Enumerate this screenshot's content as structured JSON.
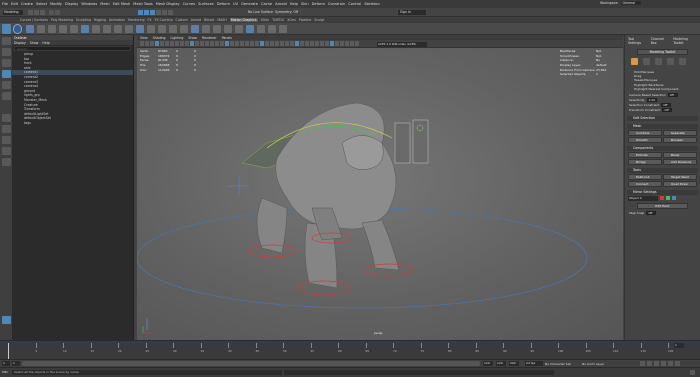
{
  "menubar": {
    "items": [
      "File",
      "Edit",
      "Create",
      "Select",
      "Modify",
      "Display",
      "Windows",
      "Mesh",
      "Edit Mesh",
      "Mesh Tools",
      "Mesh Display",
      "Curves",
      "Surfaces",
      "Deform",
      "UV",
      "Generate",
      "Cache",
      "Arnold",
      "Help",
      "Skin",
      "Deform",
      "Constrain",
      "Control",
      "Skeleton"
    ],
    "workspace_label": "Workspace:",
    "workspace_value": "General"
  },
  "statusline": {
    "mode": "Modeling",
    "symmetry": "Symmetry: Off",
    "live": "No Live Surface",
    "sign_in": "Sign In"
  },
  "shelf": {
    "tabs": [
      "Curves / Surfaces",
      "Poly Modeling",
      "Sculpting",
      "Rigging",
      "Animation",
      "Rendering",
      "FX",
      "FX Caching",
      "Custom",
      "Arnold",
      "Bifrost",
      "MASH",
      "Motion Graphics",
      "XGen",
      "TURTLE",
      "XGen",
      "Pipeline",
      "Sculpt"
    ],
    "active_index": 12
  },
  "outliner": {
    "menu": [
      "Display",
      "Show",
      "Help"
    ],
    "search_placeholder": "Search...",
    "items": [
      "persp",
      "top",
      "front",
      "side",
      "camera1",
      "camera2",
      "camera3",
      "camera4",
      "ground",
      "lights_grp",
      "Monster_Mesh",
      "Creature",
      "Transform",
      "defaultLightSet",
      "defaultObjectSet",
      "tags"
    ],
    "highlight_index": 4
  },
  "viewport": {
    "menu": [
      "View",
      "Shading",
      "Lighting",
      "Show",
      "Renderer",
      "Panels"
    ],
    "color_space": "ACES 1.0 SDR-video (ACES)",
    "camera_label": "persp",
    "hud_left": [
      [
        "Verts:",
        "87063",
        "0",
        "0"
      ],
      [
        "Edges:",
        "168374",
        "0",
        "0"
      ],
      [
        "Faces:",
        "81436",
        "0",
        "0"
      ],
      [
        "Tris:",
        "162848",
        "0",
        "0"
      ],
      [
        "UVs:",
        "110426",
        "0",
        "0"
      ]
    ],
    "hud_right": [
      [
        "Backfaces:",
        "N/A"
      ],
      [
        "Smoothness:",
        "N/A"
      ],
      [
        "Instance:",
        "No"
      ],
      [
        "Display Layer:",
        "default"
      ],
      [
        "Distance From Camera:",
        "23.891"
      ],
      [
        "Selected Objects:",
        "1"
      ]
    ]
  },
  "attribute_editor": {
    "tabs": [
      "Tool Settings",
      "Channel Box",
      "Modeling Toolkit"
    ],
    "title": "Modeling Toolkit",
    "subtabs": [
      "Object",
      "Vertex",
      "Edge",
      "Face",
      "UV"
    ],
    "pick_label": "Pick/Marquee",
    "options": [
      "Drag",
      "Tweak/Marquee",
      "Highlight Backfaces",
      "Highlight Nearest Component"
    ],
    "fields": [
      [
        "Camera Based Selection",
        "Off"
      ],
      [
        "Selectivity",
        "1.00"
      ],
      [
        "Selection Constraint",
        "Off"
      ],
      [
        "Transform Constraint",
        "Off"
      ]
    ],
    "soft_label": "Soft Selection",
    "mesh_section": "Mesh",
    "mesh_buttons": [
      "Combine",
      "Separate",
      "Smooth",
      "Boolean"
    ],
    "components_section": "Components",
    "comp_buttons": [
      "Extrude",
      "Bevel",
      "Bridge",
      "Add Divisions"
    ],
    "tools_section": "Tools",
    "tool_buttons": [
      "Multi-Cut",
      "Target Weld",
      "Connect",
      "Quad Draw"
    ],
    "edit_settings": "Mirror Settings",
    "symmetry_label": "Object X",
    "edit_pivot": "Edit Pivot",
    "step_snap": "Step Snap",
    "step_value": "Off"
  },
  "timeline": {
    "ticks": [
      "5",
      "10",
      "15",
      "20",
      "25",
      "30",
      "35",
      "40",
      "45",
      "50",
      "55",
      "60",
      "65",
      "70",
      "75",
      "80",
      "85",
      "90",
      "95",
      "100",
      "105",
      "110",
      "115",
      "120"
    ],
    "current_frame": "1"
  },
  "range": {
    "start": "1",
    "start2": "1",
    "end": "120",
    "end2": "120",
    "end3": "200",
    "fps": "24 fps",
    "char_set": "No Character Set",
    "anim_layer": "No Anim Layer"
  },
  "cmdline": {
    "lang": "MEL",
    "message": "Select all the objects in the scene by name"
  },
  "colors": {
    "menubar": "#3a3a3a",
    "panel": "#444444",
    "viewport": "#666666",
    "accent": "#4f87b8"
  }
}
